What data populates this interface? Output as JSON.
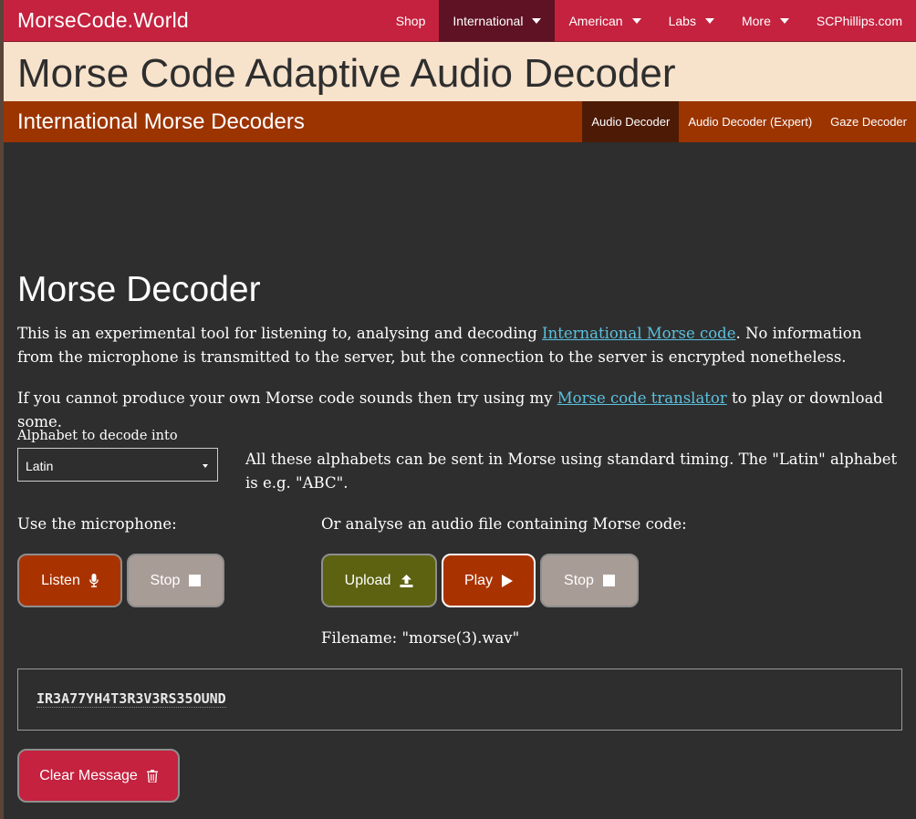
{
  "nav": {
    "brand": "MorseCode.World",
    "items": [
      {
        "label": "Shop"
      },
      {
        "label": "International"
      },
      {
        "label": "American"
      },
      {
        "label": "Labs"
      },
      {
        "label": "More"
      },
      {
        "label": "SCPhillips.com"
      }
    ]
  },
  "page_title": "Morse Code Adaptive Audio Decoder",
  "subnav": {
    "title": "International Morse Decoders",
    "items": [
      {
        "label": "Audio Decoder"
      },
      {
        "label": "Audio Decoder (Expert)"
      },
      {
        "label": "Gaze Decoder"
      }
    ]
  },
  "main": {
    "heading": "Morse Decoder",
    "intro_1": "This is an experimental tool for listening to, analysing and decoding ",
    "intro_link": "International Morse code",
    "intro_2": ". No information from the microphone is transmitted to the server, but the connection to the server is encrypted nonetheless.",
    "translator_1": "If you cannot produce your own Morse code sounds then try using my ",
    "translator_link": "Morse code translator",
    "translator_2": " to play or download some.",
    "alphabet_label": "Alphabet to decode into",
    "alphabet_value": "Latin",
    "alphabet_note": "All these alphabets can be sent in Morse using standard timing. The \"Latin\" alphabet is e.g. \"ABC\".",
    "mic_label": "Use the microphone:",
    "file_label": "Or analyse an audio file containing Morse code:",
    "listen_label": "Listen",
    "stop_label": "Stop",
    "upload_label": "Upload",
    "play_label": "Play",
    "stop2_label": "Stop",
    "filename": "Filename: \"morse(3).wav\"",
    "decoded_text": "IR3A77YH4T3R3V3RS35OUND",
    "clear_label": "Clear Message"
  },
  "colors": {
    "nav": "#c4223f",
    "title_bg": "#f7e2cb",
    "subnav": "#9c3400",
    "background": "#2e2e2e",
    "link": "#5bc0de"
  }
}
